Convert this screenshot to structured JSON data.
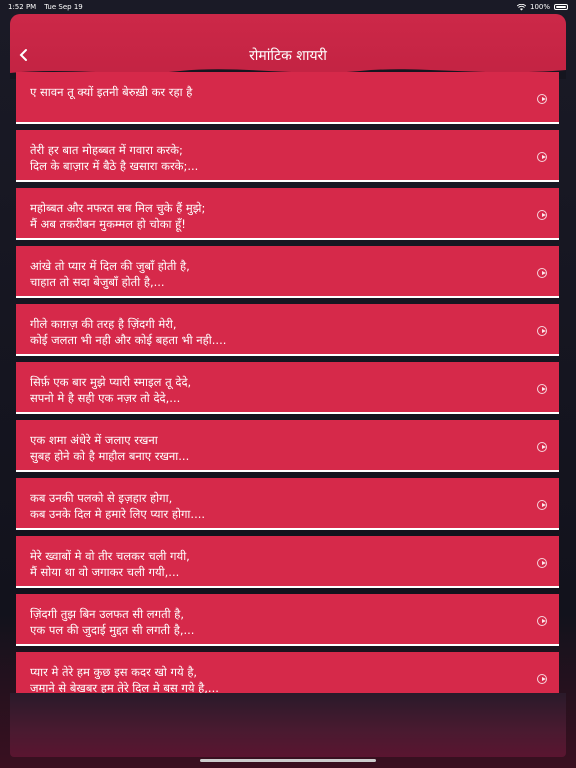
{
  "status": {
    "time": "1:52 PM",
    "date": "Tue Sep 19",
    "battery": "100%"
  },
  "header": {
    "title": "रोमांटिक शायरी",
    "back_icon": "chevron-left-icon"
  },
  "colors": {
    "header": "#c9264a",
    "card": "#d6294a",
    "background": "#15151f"
  },
  "shayari": [
    {
      "line1": "ए सावन तू क्यों इतनी बेरुख़ी कर रहा है",
      "line2": ""
    },
    {
      "line1": "तेरी हर बात मोहब्बत में गवारा करके;",
      "line2": "दिल के बाज़ार में बैठे है खसारा करके;..."
    },
    {
      "line1": "महोब्बत और नफरत सब मिल चुके हैं मुझे;",
      "line2": "मैं अब तकरीबन मुकम्मल हो चोका हूँ!"
    },
    {
      "line1": "आंखे तो प्यार में दिल की जुबाँ होती है,",
      "line2": "चाहात तो सदा बेजुबाँ होती है,..."
    },
    {
      "line1": "गीले काग़ज़ की तरह है ज़िंदगी मेरी,",
      "line2": "कोई जलता भी नही और कोई बहता भी नही...."
    },
    {
      "line1": "सिर्फ़ एक बार मुझे प्यारी स्माइल तू देदे,",
      "line2": "सपनो मे है सही एक नज़र तो देदे,..."
    },
    {
      "line1": "एक शमा अंधेरे में जलाए रखना",
      "line2": "सुबह होने को है माहौल बनाए रखना..."
    },
    {
      "line1": "कब उनकी पलको से इज़हार होगा,",
      "line2": "कब उनके दिल मे हमारे लिए प्यार होगा...."
    },
    {
      "line1": "मेरे ख्वाबों मे वो तीर चलकर चली गयी,",
      "line2": "मैं सोया था वो जगाकर चली गयी,..."
    },
    {
      "line1": "ज़िंदगी तुझ बिन उलफत सी लगती है,",
      "line2": "एक पल की जुदाई मुद्दत सी लगती है,..."
    },
    {
      "line1": "प्यार मे तेरे हम कुछ इस कदर खो गये है,",
      "line2": "जमाने से बेखबर हम तेरे दिल मे बस गये है,..."
    }
  ]
}
